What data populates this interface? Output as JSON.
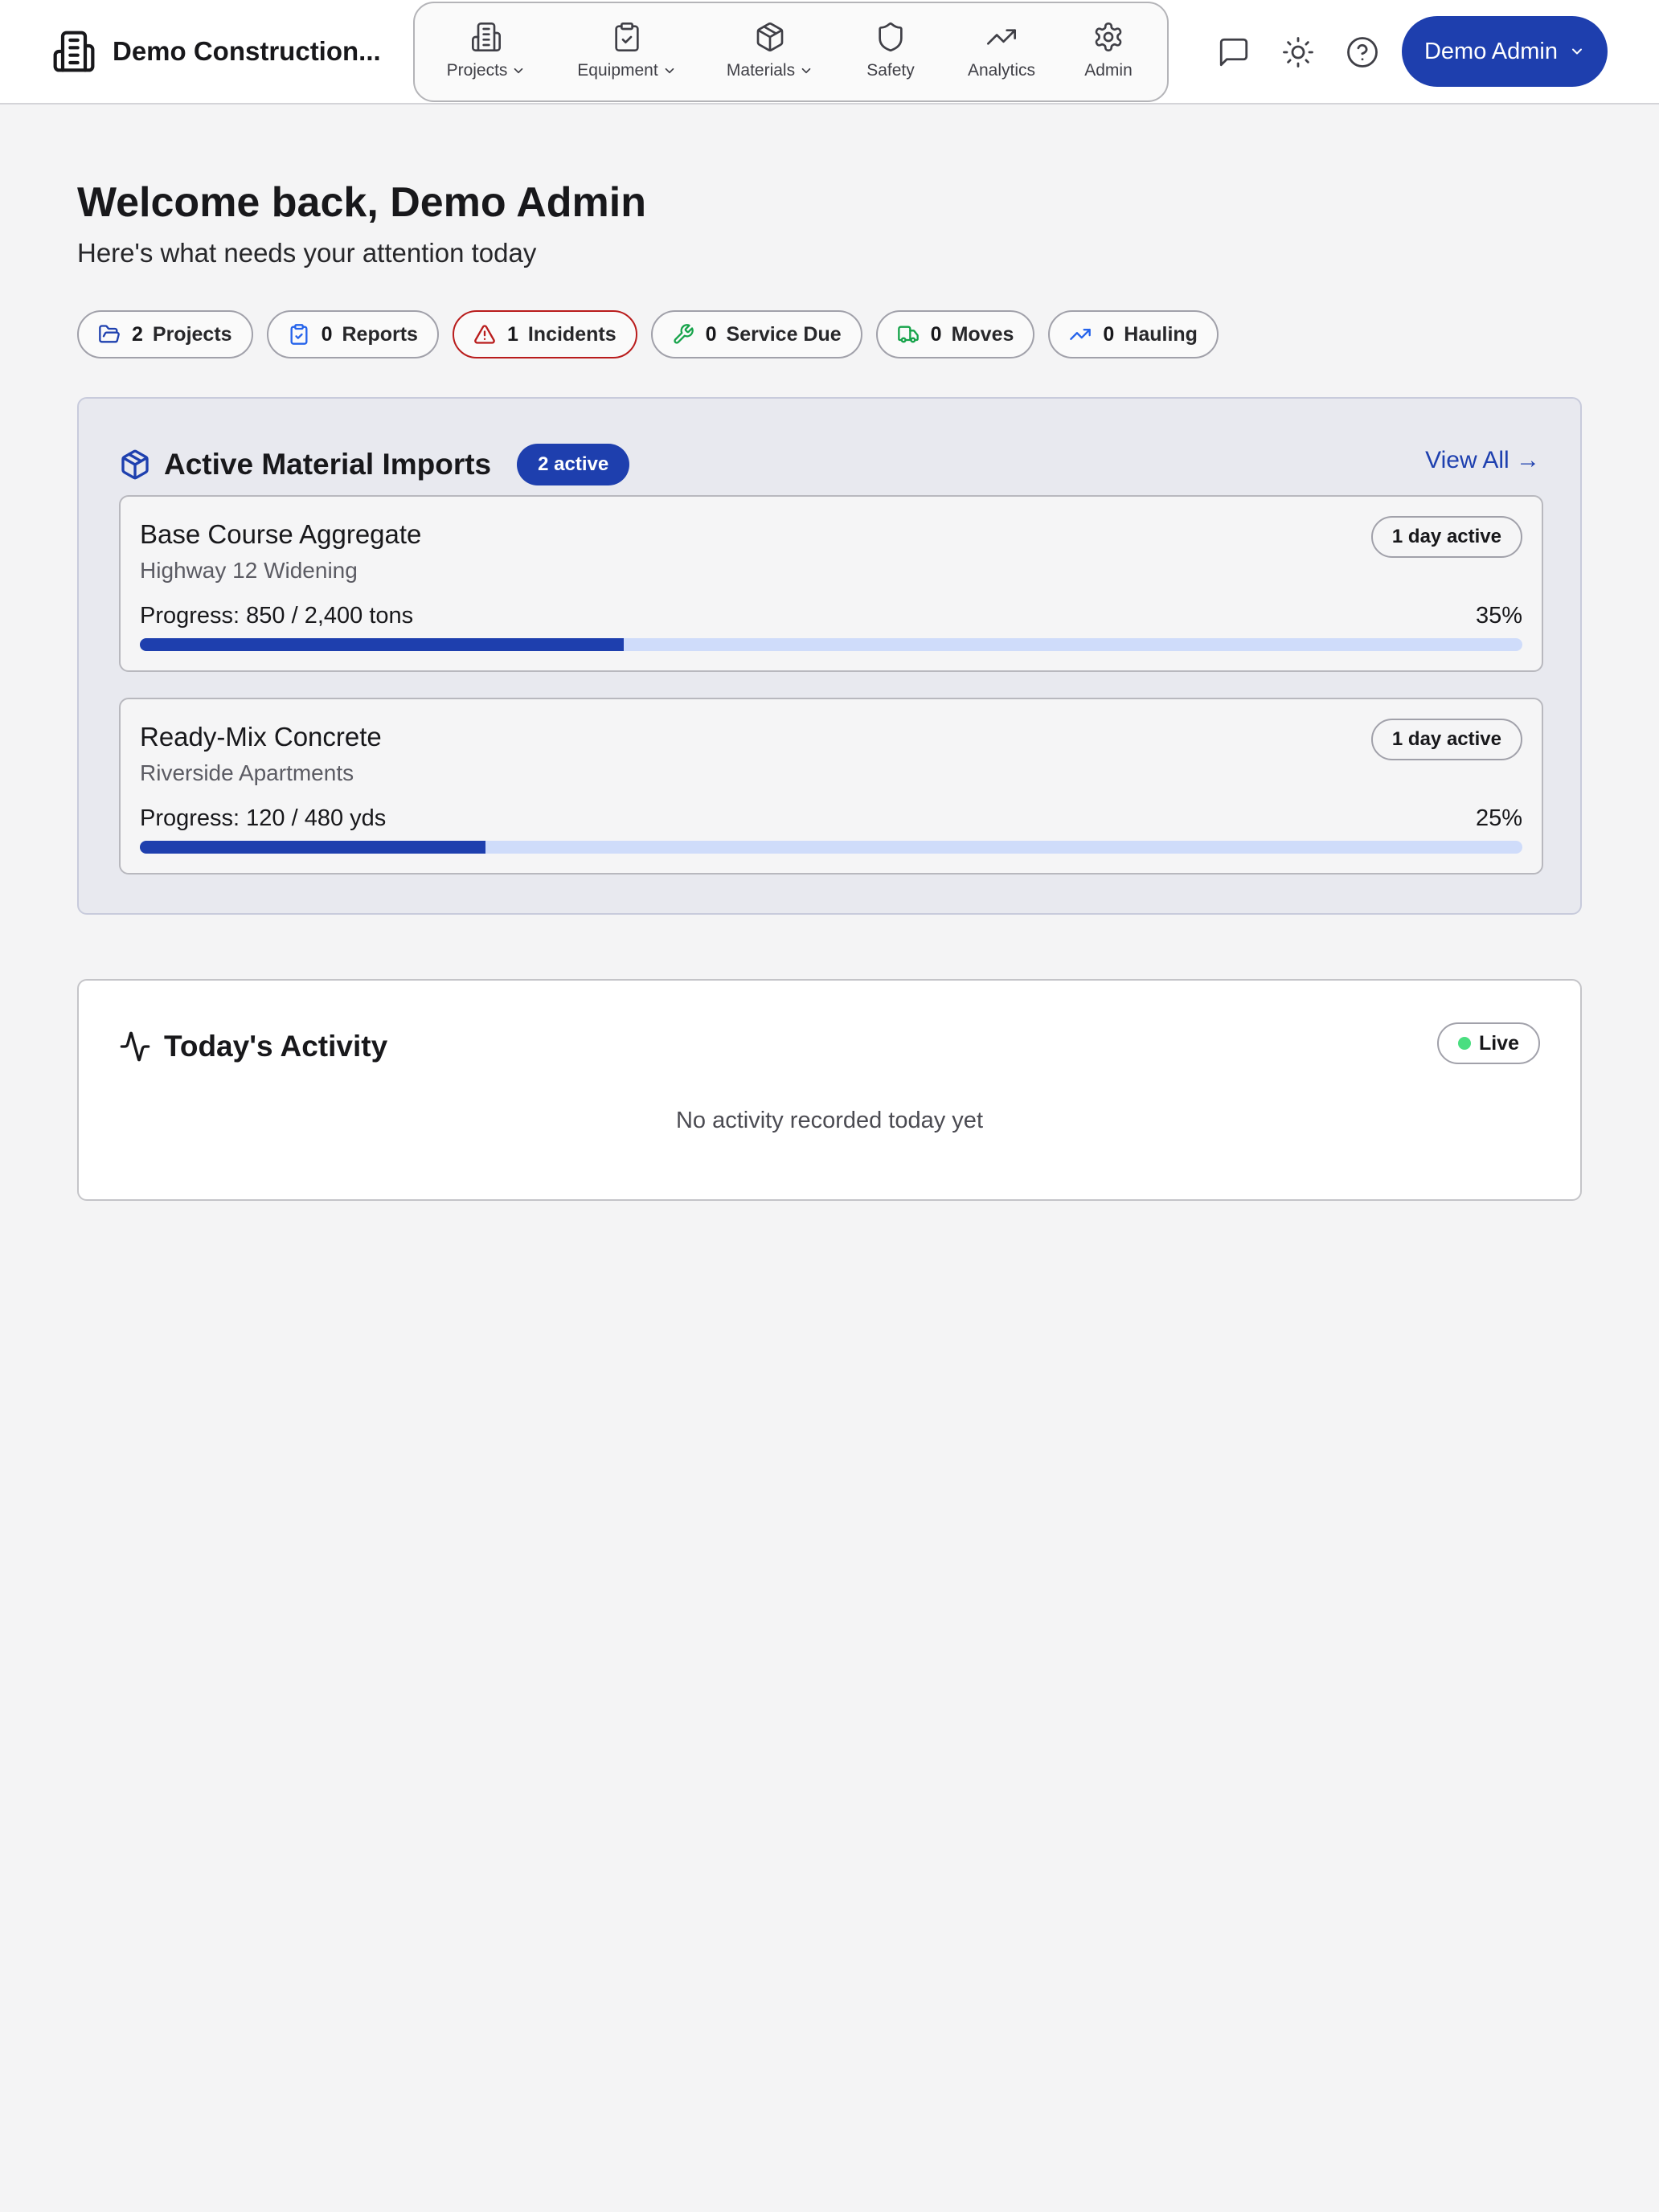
{
  "header": {
    "brand_name": "Demo Construction...",
    "brand_icon": "building-icon",
    "nav": [
      {
        "label": "Projects",
        "icon": "building-icon",
        "has_dropdown": true
      },
      {
        "label": "Equipment",
        "icon": "clipboard-check-icon",
        "has_dropdown": true
      },
      {
        "label": "Materials",
        "icon": "package-icon",
        "has_dropdown": true
      },
      {
        "label": "Safety",
        "icon": "shield-icon",
        "has_dropdown": false
      },
      {
        "label": "Analytics",
        "icon": "trending-up-icon",
        "has_dropdown": false
      },
      {
        "label": "Admin",
        "icon": "gear-icon",
        "has_dropdown": false
      }
    ],
    "actions": [
      "message-icon",
      "sun-icon",
      "help-icon"
    ],
    "user_label": "Demo Admin"
  },
  "welcome": {
    "title": "Welcome back, Demo Admin",
    "subtitle": "Here's what needs your attention today"
  },
  "stats": [
    {
      "count": "2",
      "label": "Projects",
      "icon": "folder-open-icon",
      "color": "#1e40af"
    },
    {
      "count": "0",
      "label": "Reports",
      "icon": "clipboard-check-icon",
      "color": "#2563eb"
    },
    {
      "count": "1",
      "label": "Incidents",
      "icon": "alert-triangle-icon",
      "color": "#b91c1c"
    },
    {
      "count": "0",
      "label": "Service Due",
      "icon": "wrench-icon",
      "color": "#16a34a"
    },
    {
      "count": "0",
      "label": "Moves",
      "icon": "truck-icon",
      "color": "#16a34a"
    },
    {
      "count": "0",
      "label": "Hauling",
      "icon": "trending-up-icon",
      "color": "#2563eb"
    }
  ],
  "imports": {
    "title": "Active Material Imports",
    "badge": "2 active",
    "view_all": "View All →",
    "items": [
      {
        "name": "Base Course Aggregate",
        "project": "Highway 12 Widening",
        "duration": "1 day active",
        "progress_text": "Progress: 850 / 2,400 tons",
        "percent_text": "35%",
        "percent": 35
      },
      {
        "name": "Ready-Mix Concrete",
        "project": "Riverside Apartments",
        "duration": "1 day active",
        "progress_text": "Progress: 120 / 480 yds",
        "percent_text": "25%",
        "percent": 25
      }
    ]
  },
  "activity": {
    "title": "Today's Activity",
    "live_label": "Live",
    "empty_message": "No activity recorded today yet"
  },
  "colors": {
    "accent": "#1e3fae",
    "progress_track": "#cfdcfa",
    "danger": "#b91c1c",
    "live": "#4ade80"
  }
}
